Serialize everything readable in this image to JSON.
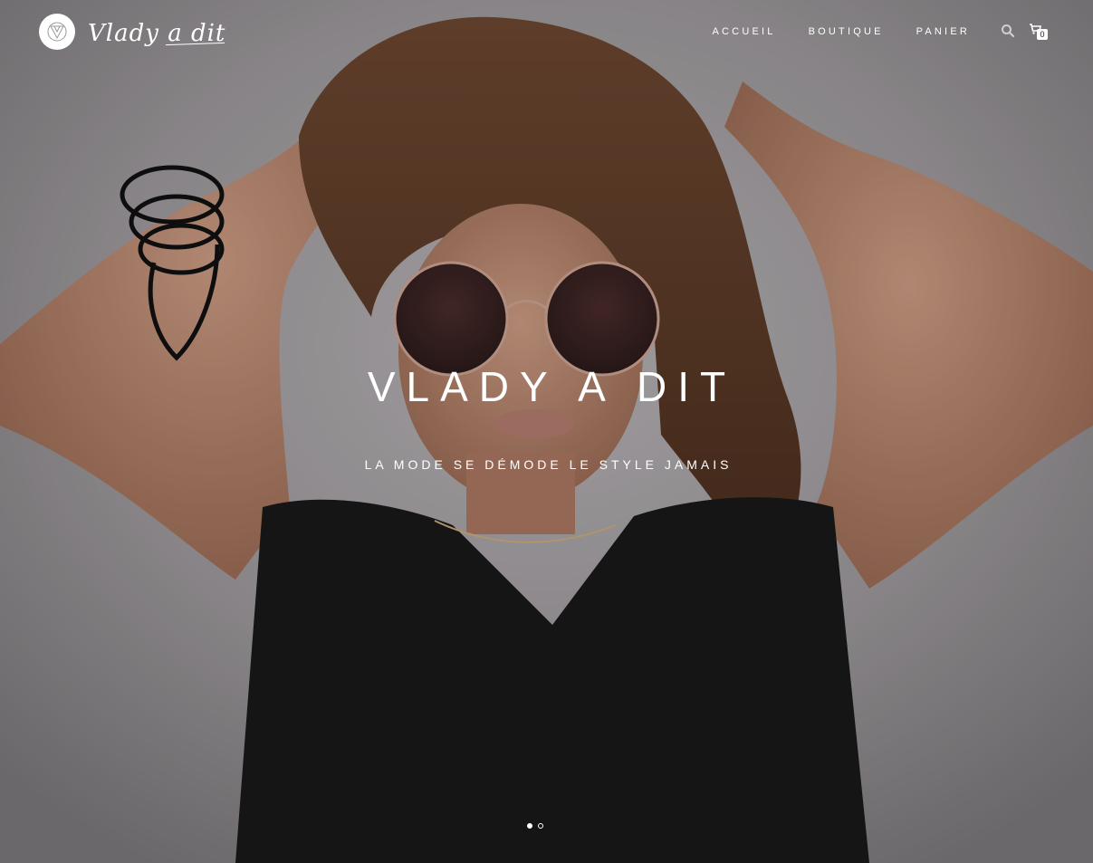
{
  "brand": {
    "logo_text": "Vlady a dit",
    "logo_icon": "triangle-crest-icon"
  },
  "nav": {
    "items": [
      {
        "label": "ACCUEIL"
      },
      {
        "label": "BOUTIQUE"
      },
      {
        "label": "PANIER"
      }
    ],
    "search_icon": "search-icon",
    "cart_icon": "cart-icon",
    "cart_count": "0"
  },
  "hero": {
    "title": "VLADY A DIT",
    "subtitle": "LA MODE SE DÉMODE LE STYLE JAMAIS",
    "slides_total": 2,
    "active_slide": 1
  },
  "colors": {
    "text": "#ffffff",
    "backdrop": "#8d8a8d",
    "top": "#191919"
  }
}
